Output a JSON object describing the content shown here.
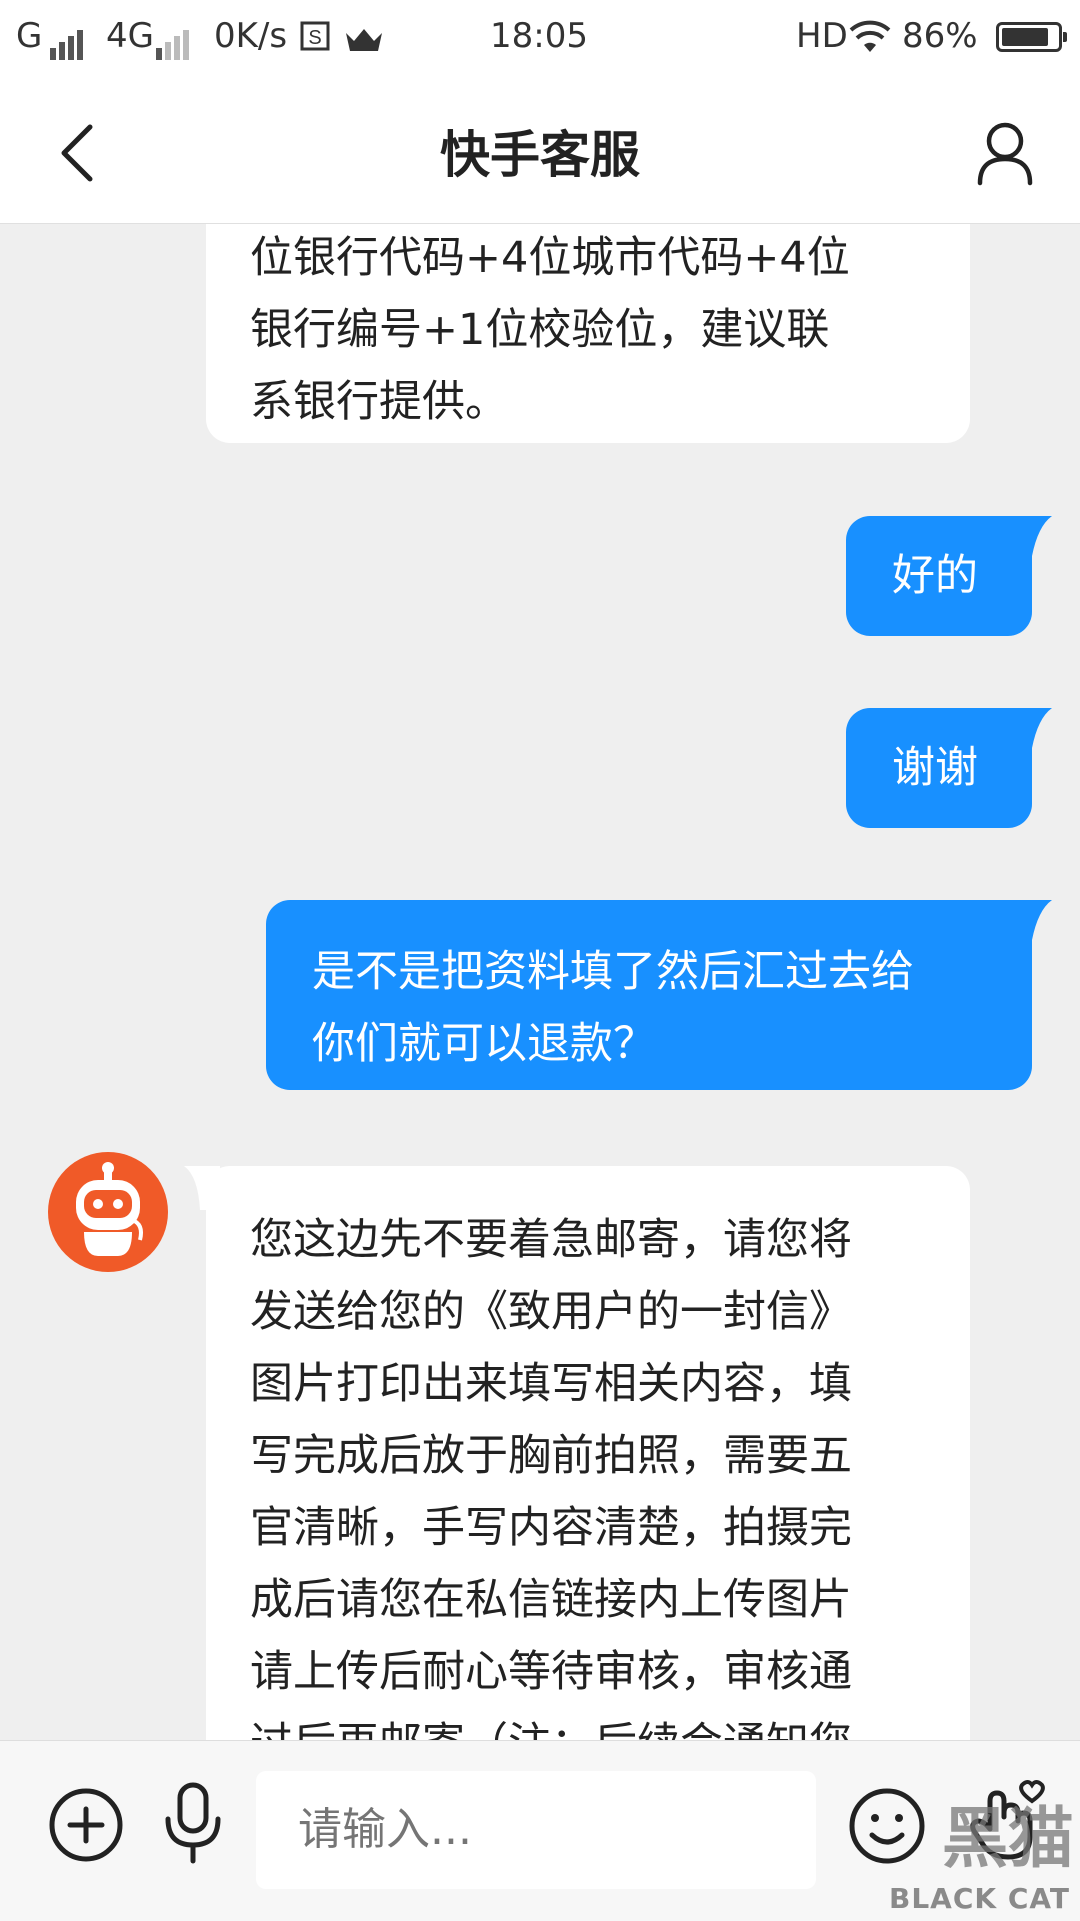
{
  "status_bar": {
    "carrier1": "G",
    "carrier2": "4G",
    "speed": "0K/s",
    "time": "18:05",
    "hd": "HD",
    "battery": "86%",
    "battery_level": 0.86
  },
  "header": {
    "title": "快手客服"
  },
  "messages": [
    {
      "side": "in",
      "text": "位银行代码+4位城市代码+4位\n银行编号+1位校验位，建议联\n系银行提供。"
    },
    {
      "side": "out",
      "text": "好的"
    },
    {
      "side": "out",
      "text": "谢谢"
    },
    {
      "side": "out",
      "text": "是不是把资料填了然后汇过去给\n你们就可以退款？"
    },
    {
      "side": "in",
      "text": "您这边先不要着急邮寄，请您将\n发送给您的《致用户的一封信》\n图片打印出来填写相关内容，填\n写完成后放于胸前拍照，需要五\n官清晰，手写内容清楚，拍摄完\n成后请您在私信链接内上传图片\n请上传后耐心等待审核，审核通\n过后再邮寄（注：后续会通知您"
    }
  ],
  "input": {
    "placeholder": "请输入..."
  },
  "watermark": {
    "big": "黑猫",
    "small": "BLACK CAT"
  },
  "colors": {
    "accent": "#1890ff",
    "avatar_bg": "#f05a28",
    "background": "#efefef"
  }
}
